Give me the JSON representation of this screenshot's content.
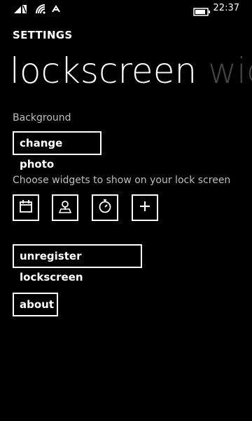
{
  "status_bar": {
    "time": "22:37",
    "icons": [
      "sim-icon",
      "wifi-icon",
      "data-sync-icon",
      "battery-icon"
    ]
  },
  "header": {
    "app_title": "SETTINGS"
  },
  "pivot": {
    "active": "lockscreen",
    "next": "wid"
  },
  "background_section": {
    "label": "Background",
    "change_photo_button": "change photo"
  },
  "widgets_section": {
    "label": "Choose widgets to show on your lock screen",
    "slots": [
      "calendar-icon",
      "maps-icon",
      "alarm-icon",
      "add-icon"
    ]
  },
  "unregister_button": "unregister lockscreen",
  "about_button": "about",
  "colors": {
    "background": "#000000",
    "foreground": "#ffffff",
    "muted": "#bfbfbf",
    "inactive_pivot": "#444444"
  }
}
